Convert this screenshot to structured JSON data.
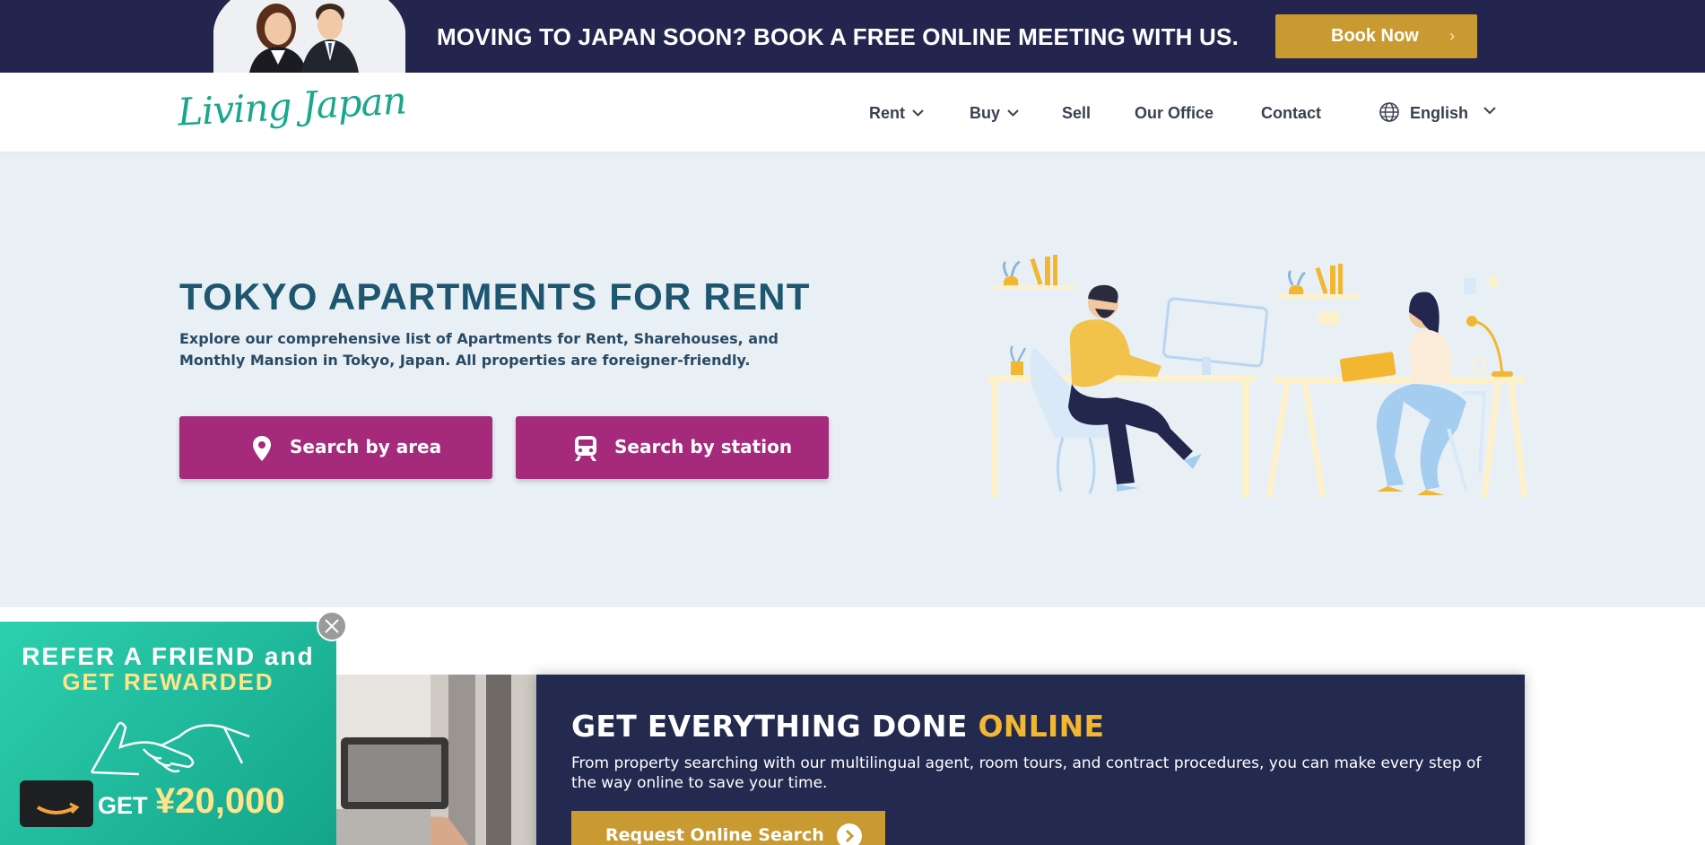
{
  "promo": {
    "text": "MOVING TO JAPAN SOON? BOOK A FREE ONLINE MEETING WITH US.",
    "button_label": "Book Now",
    "button_chevron": "›"
  },
  "header": {
    "logo_text": "Living Japan",
    "nav": [
      {
        "label": "Rent",
        "has_dropdown": true
      },
      {
        "label": "Buy",
        "has_dropdown": true
      },
      {
        "label": "Sell",
        "has_dropdown": false
      },
      {
        "label": "Our Office",
        "has_dropdown": false
      },
      {
        "label": "Contact",
        "has_dropdown": false
      }
    ],
    "language": "English"
  },
  "hero": {
    "title": "TOKYO APARTMENTS FOR RENT",
    "description": "Explore our comprehensive list of Apartments for Rent, Sharehouses, and Monthly Mansion in Tokyo, Japan. All properties are foreigner-friendly.",
    "search_area_label": "Search by area",
    "search_station_label": "Search by station"
  },
  "online": {
    "title_main": "GET EVERYTHING DONE ",
    "title_accent": "ONLINE",
    "description": "From property searching with our multilingual agent, room tours, and contract procedures, you can make every step of the way online to save your time.",
    "button_label": "Request Online Search"
  },
  "referral": {
    "line1": "REFER A FRIEND and",
    "line2": "GET REWARDED",
    "get": "GET",
    "amount": "¥20,000"
  },
  "colors": {
    "navy": "#24254f",
    "gold": "#c99a32",
    "magenta": "#a52a7c",
    "teal": "#1aa78c",
    "hero_bg": "#e8f0f6",
    "title_blue": "#1e5670",
    "accent_yellow": "#f2b631"
  },
  "icons": [
    "map-pin-icon",
    "train-icon",
    "globe-icon",
    "chevron-down-icon",
    "close-icon",
    "arrow-right-icon",
    "amazon-logo-icon",
    "handshake-icon"
  ]
}
